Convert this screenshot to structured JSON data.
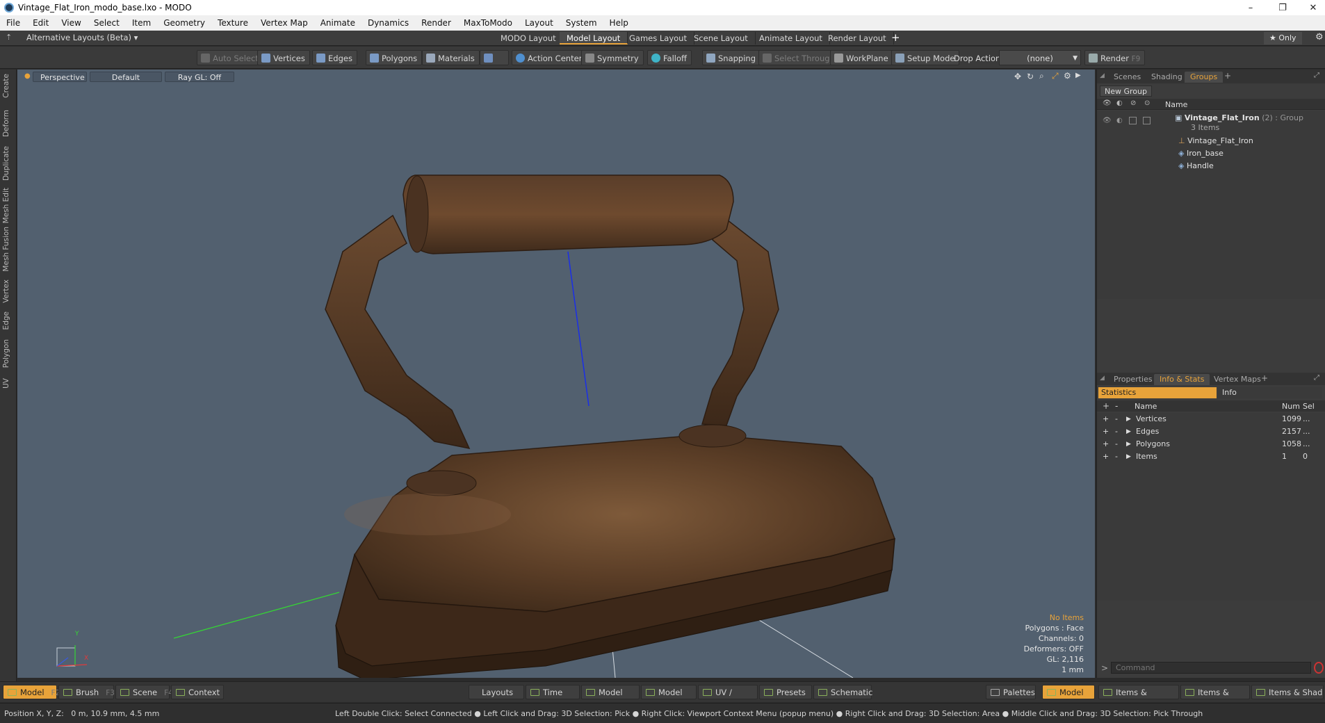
{
  "window": {
    "title": "Vintage_Flat_Iron_modo_base.lxo - MODO",
    "minimize": "–",
    "restore": "❐",
    "close": "✕"
  },
  "menu": [
    "File",
    "Edit",
    "View",
    "Select",
    "Item",
    "Geometry",
    "Texture",
    "Vertex Map",
    "Animate",
    "Dynamics",
    "Render",
    "MaxToModo",
    "Layout",
    "System",
    "Help"
  ],
  "layouts": {
    "selector": "Alternative Layouts (Beta) ▾",
    "tabs": [
      "MODO Layout",
      "Model Layout",
      "Games Layout",
      "Scene Layout",
      "Animate Layout",
      "Render Layout"
    ],
    "active_tab": "Model Layout",
    "add": "+",
    "only": "★  Only",
    "gear": "⚙"
  },
  "toolbar": {
    "auto_select": "Auto Select",
    "vertices": "Vertices",
    "edges": "Edges",
    "polygons": "Polygons",
    "materials": "Materials",
    "action_center": "Action Center",
    "symmetry": "Symmetry",
    "falloff": "Falloff",
    "snapping": "Snapping",
    "select_through": "Select Through",
    "workplane": "WorkPlane",
    "setup_mode": "Setup Mode",
    "drop_action_label": "Drop Action",
    "drop_action_value": "(none)",
    "render": "Render",
    "render_key": "F9"
  },
  "left_tabs": [
    "Create",
    "Deform",
    "Duplicate",
    "Mesh Edit",
    "Mesh Fusion",
    "Vertex",
    "Edge",
    "Polygon",
    "UV"
  ],
  "viewport": {
    "view": "Perspective",
    "shading": "Default",
    "raygl": "Ray GL: Off",
    "info": {
      "selection": "No Items",
      "polygons": "Polygons : Face",
      "channels": "Channels: 0",
      "deformers": "Deformers: OFF",
      "gl": "GL: 2,116",
      "unit": "1 mm"
    },
    "axis_y": "Y",
    "axis_x": "X"
  },
  "groups_panel": {
    "tabs": [
      "Scenes",
      "Shading",
      "Groups"
    ],
    "active_tab": "Groups",
    "add": "+",
    "new_group": "New Group",
    "col_name": "Name",
    "group_name": "Vintage_Flat_Iron",
    "group_suffix": "(2) : Group",
    "group_count": "3 Items",
    "items": [
      "Vintage_Flat_Iron",
      "Iron_base",
      "Handle"
    ]
  },
  "stats_panel": {
    "tabs": [
      "Properties",
      "Info & Stats",
      "Vertex Maps"
    ],
    "active_tab": "Info & Stats",
    "add": "+",
    "subtabs": [
      "Statistics",
      "Info"
    ],
    "col_name": "Name",
    "col_num": "Num",
    "col_sel": "Sel",
    "rows": [
      {
        "name": "Vertices",
        "num": "1099",
        "sel": "..."
      },
      {
        "name": "Edges",
        "num": "2157",
        "sel": "..."
      },
      {
        "name": "Polygons",
        "num": "1058",
        "sel": "..."
      },
      {
        "name": "Items",
        "num": "1",
        "sel": "0"
      }
    ],
    "command_prompt": ">",
    "command_placeholder": "Command"
  },
  "bottom": {
    "model": "Model",
    "model_key": "F2",
    "brush": "Brush",
    "brush_key": "F3",
    "scene": "Scene",
    "scene_key": "F4",
    "context": "Context",
    "layouts": "Layouts",
    "time": "Time",
    "model_quad": "Model Quad",
    "model_tri": "Model Tri",
    "uv_model": "UV / Model",
    "presets": "Presets",
    "schematic": "Schematic",
    "palettes": "Palettes",
    "model_right": "Model",
    "items_properties": "Items & Properties",
    "items_groups": "Items & Groups",
    "items_shading": "Items & Shading"
  },
  "status": {
    "position": "Position X, Y, Z:   0 m, 10.9 mm, 4.5 mm",
    "hint": "Left Double Click: Select Connected ● Left Click and Drag: 3D Selection: Pick ● Right Click: Viewport Context Menu (popup menu) ● Right Click and Drag: 3D Selection: Area ● Middle Click and Drag: 3D Selection: Pick Through"
  },
  "colors": {
    "accent": "#e8a33a",
    "viewport_bg": "#52606f",
    "rust": "#6b4a30"
  }
}
